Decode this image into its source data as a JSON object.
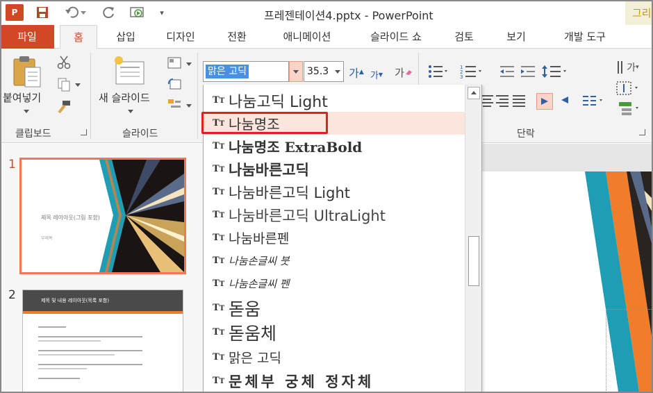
{
  "app": {
    "logo_text": "P",
    "window_title": "프레젠테이션4.pptx - PowerPoint",
    "partial_tab": "그리"
  },
  "tabs": [
    {
      "label": "파일"
    },
    {
      "label": "홈"
    },
    {
      "label": "삽입"
    },
    {
      "label": "디자인"
    },
    {
      "label": "전환"
    },
    {
      "label": "애니메이션"
    },
    {
      "label": "슬라이드 쇼"
    },
    {
      "label": "검토"
    },
    {
      "label": "보기"
    },
    {
      "label": "개발 도구"
    }
  ],
  "ribbon": {
    "clipboard": {
      "paste_label": "붙여넣기",
      "group_label": "클립보드"
    },
    "slides": {
      "new_slide_label": "새 슬라이드",
      "group_label": "슬라이드"
    },
    "font": {
      "current_font": "맑은 고딕",
      "current_size": "35.3",
      "grow_glyph": "가",
      "shrink_glyph": "가",
      "clear_glyph": "가"
    },
    "paragraph": {
      "group_label": "단락",
      "text_dir_glyph": "가"
    }
  },
  "font_dropdown": {
    "items": [
      {
        "name": "나눔고딕 Light"
      },
      {
        "name": "나눔명조"
      },
      {
        "name": "나눔명조 ExtraBold"
      },
      {
        "name": "나눔바른고딕"
      },
      {
        "name": "나눔바른고딕 Light"
      },
      {
        "name": "나눔바른고딕 UltraLight"
      },
      {
        "name": "나눔바른펜"
      },
      {
        "name": "나눔손글씨 붓"
      },
      {
        "name": "나눔손글씨 펜"
      },
      {
        "name": "돋움"
      },
      {
        "name": "돋움체"
      },
      {
        "name": "맑은 고딕"
      },
      {
        "name": "문체부 궁체 정자체"
      }
    ],
    "highlighted_index": 1
  },
  "slides_panel": {
    "slide1": {
      "number": "1",
      "title": "제목 레이아웃(그림 포함)",
      "subtitle": "부제목"
    },
    "slide2": {
      "number": "2",
      "header": "제목 및 내용 레이아웃(목록 포함)"
    }
  },
  "colors": {
    "accent": "#d24726",
    "highlight": "#fbe5dd",
    "callout": "#e22020",
    "thumb_teal": "#1e9db5",
    "thumb_orange": "#f07d2a"
  }
}
